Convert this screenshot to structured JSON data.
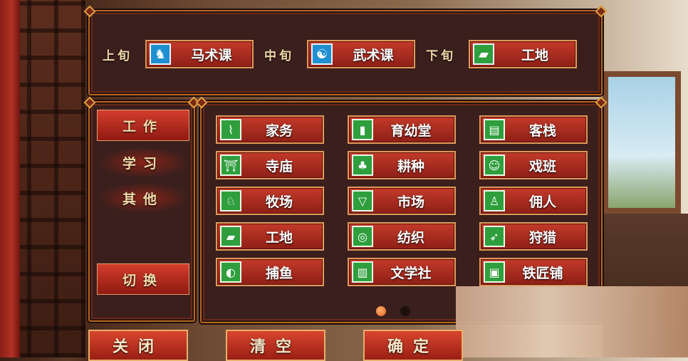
{
  "schedule": {
    "slots": [
      {
        "label": "上旬",
        "value": "马术课",
        "icon": "horse-icon",
        "icon_color": "#1e8fd0"
      },
      {
        "label": "中旬",
        "value": "武术课",
        "icon": "yin-yang-icon",
        "icon_color": "#1e8fd0"
      },
      {
        "label": "下旬",
        "value": "工地",
        "icon": "construction-icon",
        "icon_color": "#2f9e3d"
      }
    ]
  },
  "sidebar": {
    "tabs": [
      {
        "label": "工作",
        "active": true
      },
      {
        "label": "学习",
        "active": false
      },
      {
        "label": "其他",
        "active": false
      }
    ],
    "switch_label": "切换"
  },
  "grid": {
    "items": [
      {
        "label": "家务",
        "icon": "broom-icon"
      },
      {
        "label": "育幼堂",
        "icon": "bottle-icon"
      },
      {
        "label": "客栈",
        "icon": "sign-icon"
      },
      {
        "label": "寺庙",
        "icon": "temple-icon"
      },
      {
        "label": "耕种",
        "icon": "sprout-icon"
      },
      {
        "label": "戏班",
        "icon": "mask-icon"
      },
      {
        "label": "牧场",
        "icon": "fence-icon"
      },
      {
        "label": "市场",
        "icon": "stall-icon"
      },
      {
        "label": "佣人",
        "icon": "servant-icon"
      },
      {
        "label": "工地",
        "icon": "construction-icon"
      },
      {
        "label": "纺织",
        "icon": "cloth-icon"
      },
      {
        "label": "狩猎",
        "icon": "arrows-icon"
      },
      {
        "label": "捕鱼",
        "icon": "fish-icon"
      },
      {
        "label": "文学社",
        "icon": "book-icon"
      },
      {
        "label": "铁匠铺",
        "icon": "forge-icon"
      }
    ],
    "page": 1,
    "page_count": 2
  },
  "footer": {
    "close_label": "关闭",
    "clear_label": "清空",
    "confirm_label": "确定"
  },
  "colors": {
    "button_red": "#c33a2a",
    "icon_green": "#2f9e3d",
    "icon_blue": "#1e8fd0",
    "gold_border": "#e09a5a"
  }
}
